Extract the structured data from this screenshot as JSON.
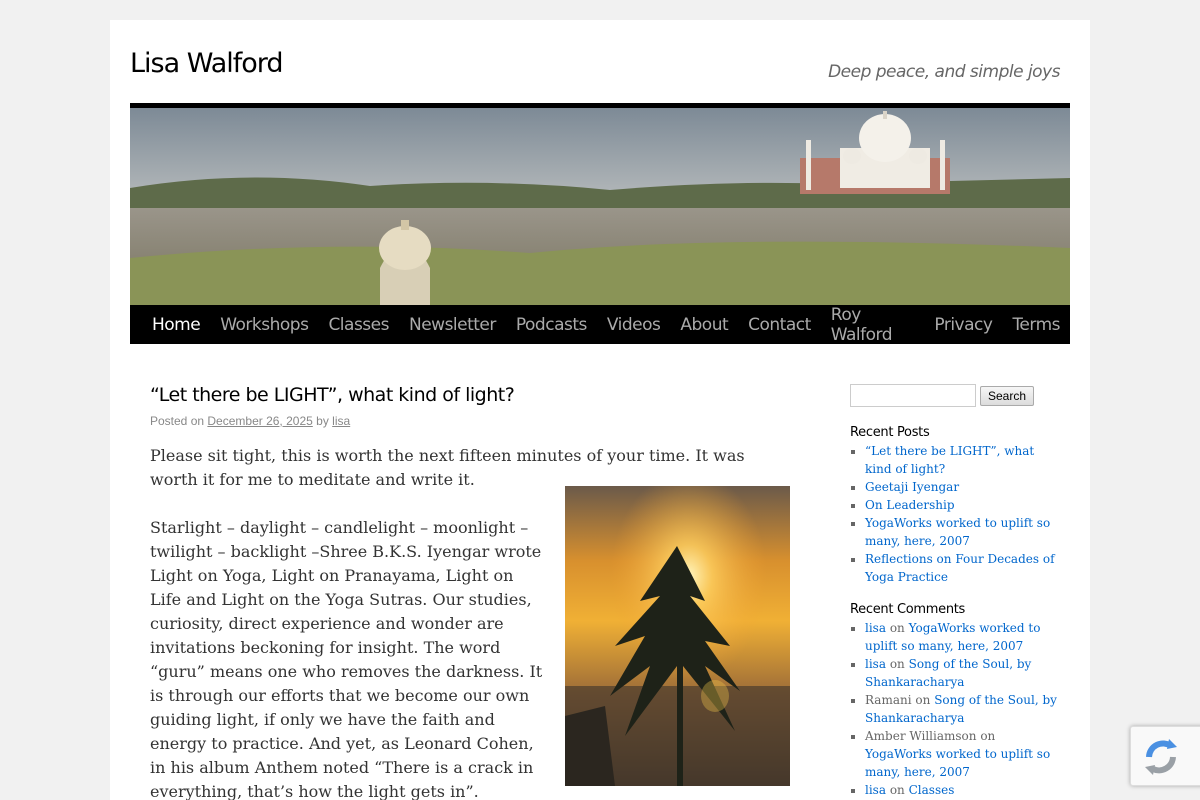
{
  "site": {
    "title": "Lisa Walford",
    "description": "Deep peace, and simple joys"
  },
  "nav": {
    "items": [
      "Home",
      "Workshops",
      "Classes",
      "Newsletter",
      "Podcasts",
      "Videos",
      "About",
      "Contact",
      "Roy Walford",
      "Privacy",
      "Terms"
    ],
    "current": "Home"
  },
  "post": {
    "title": "“Let there be LIGHT”, what kind of light?",
    "posted_on_label": "Posted on",
    "date": "December 26, 2025",
    "by_label": "by",
    "author": "lisa",
    "paragraph1": "Please sit tight, this is worth the next fifteen minutes of your time. It was worth it for me to meditate and write it.",
    "paragraph2": "Starlight – daylight – candlelight – moonlight – twilight – backlight –Shree B.K.S. Iyengar wrote Light on Yoga, Light on Pranayama, Light on Life and Light on the Yoga Sutras. Our studies, curiosity, direct experience and wonder are invitations beckoning for insight. The word “guru” means one who removes the darkness. It is through our efforts that we become our own guiding light, if only we have the faith and energy to practice. And yet, as Leonard Cohen, in his album Anthem noted “There is a crack in everything, that’s how the light gets in”."
  },
  "sidebar": {
    "search_button": "Search",
    "search_value": "",
    "recent_posts_title": "Recent Posts",
    "recent_posts": [
      "“Let there be LIGHT”, what kind of light?",
      "Geetaji Iyengar",
      "On Leadership",
      "YogaWorks worked to uplift so many, here, 2007",
      "Reflections on Four Decades of Yoga Practice"
    ],
    "recent_comments_title": "Recent Comments",
    "on_label": "on",
    "recent_comments": [
      {
        "author": "lisa",
        "author_linked": true,
        "post": "YogaWorks worked to uplift so many, here, 2007"
      },
      {
        "author": "lisa",
        "author_linked": true,
        "post": "Song of the Soul, by Shankaracharya"
      },
      {
        "author": "Ramani",
        "author_linked": false,
        "post": "Song of the Soul, by Shankaracharya"
      },
      {
        "author": "Amber Williamson",
        "author_linked": false,
        "post": "YogaWorks worked to uplift so many, here, 2007"
      },
      {
        "author": "lisa",
        "author_linked": true,
        "post": "Classes"
      }
    ]
  },
  "colors": {
    "link": "#0066cc",
    "nav_bg": "#000000",
    "page_bg": "#f1f1f1"
  },
  "icons": [
    "recaptcha-icon"
  ]
}
